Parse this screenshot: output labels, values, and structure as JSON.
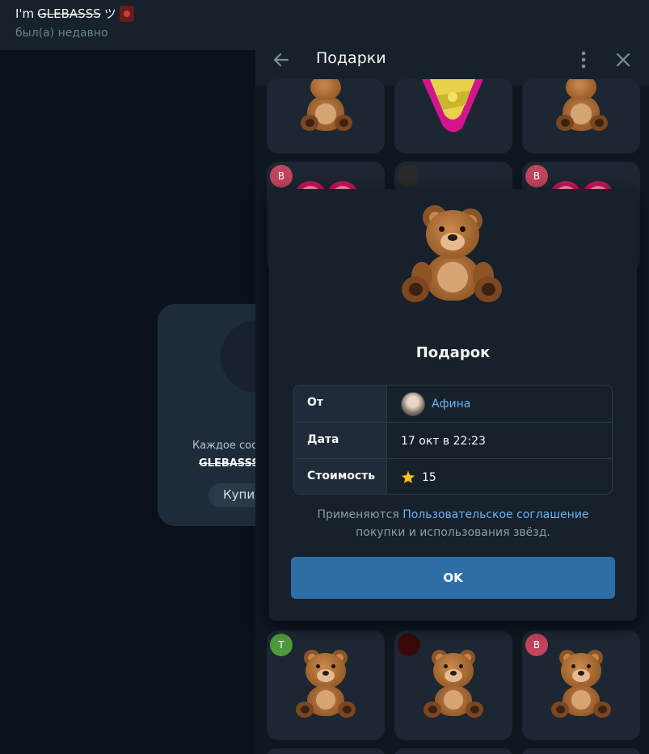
{
  "chat": {
    "title_prefix": "I'm",
    "title_name": "GLEBASSS",
    "title_suffix": "ツ",
    "status": "был(а) недавно",
    "card_text": "Каждое сос",
    "card_name": "GLEBASSS",
    "card_button": "Купи"
  },
  "panel": {
    "title": "Подарки",
    "icons": {
      "back": "arrow-left-icon",
      "more": "more-vertical-icon",
      "close": "close-icon"
    },
    "badges": [
      {
        "letter": "В",
        "color": "#c0455d"
      },
      {
        "letter": "В",
        "color": "#c0455d"
      },
      {
        "letter": "Т",
        "color": "#4f9a3c"
      },
      {
        "letter": "В",
        "color": "#c0455d"
      }
    ]
  },
  "modal": {
    "title": "Подарок",
    "rows": [
      {
        "label": "От",
        "value": "Афина"
      },
      {
        "label": "Дата",
        "value": "17 окт в 22:23"
      },
      {
        "label": "Стоимость",
        "value": "15"
      }
    ],
    "terms_prefix": "Применяются",
    "terms_link": "Пользовательское соглашение",
    "terms_suffix": "покупки и использования звёзд.",
    "ok_button": "OK"
  },
  "colors": {
    "accent": "#6ab2f2",
    "button": "#2f6ea5",
    "panel_bg": "#17212b"
  }
}
